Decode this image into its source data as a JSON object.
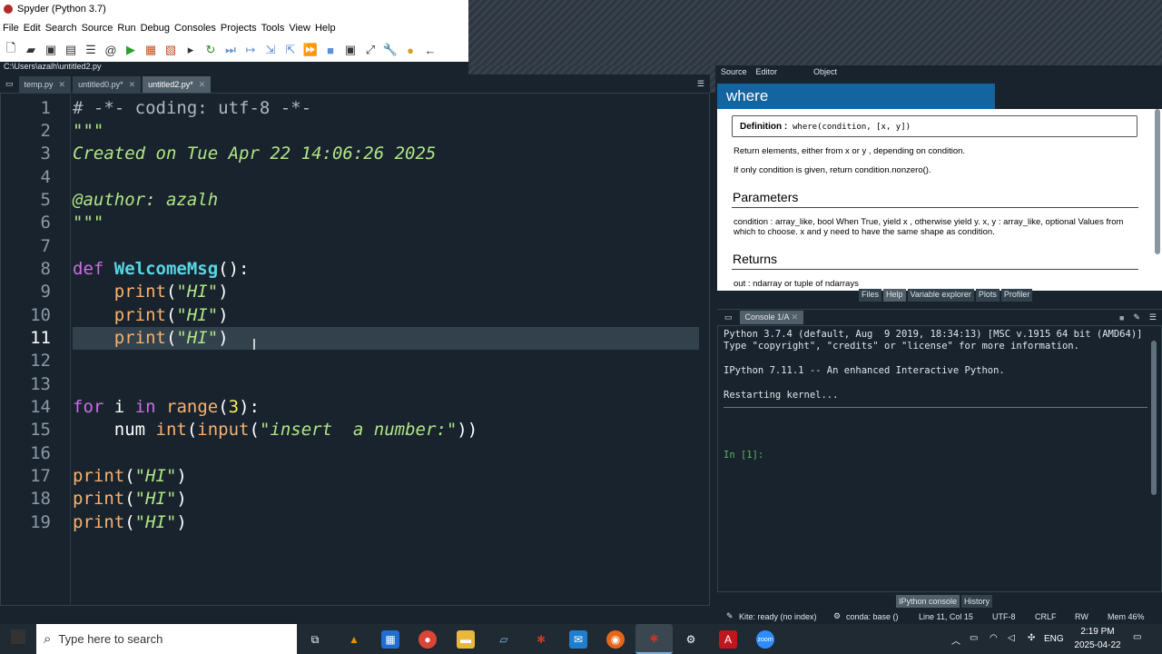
{
  "window": {
    "title": "Spyder (Python 3.7)"
  },
  "menu": [
    "File",
    "Edit",
    "Search",
    "Source",
    "Run",
    "Debug",
    "Consoles",
    "Projects",
    "Tools",
    "View",
    "Help"
  ],
  "path": "C:\\Users\\azalh\\untitled2.py",
  "file_tabs": [
    {
      "label": "temp.py"
    },
    {
      "label": "untitled0.py*"
    },
    {
      "label": "untitled2.py*"
    }
  ],
  "editor": {
    "line_numbers": [
      "1",
      "2",
      "3",
      "4",
      "5",
      "6",
      "7",
      "8",
      "9",
      "10",
      "11",
      "12",
      "13",
      "14",
      "15",
      "16",
      "17",
      "18",
      "19"
    ],
    "current_line": "11"
  },
  "help": {
    "tabs": {
      "source": "Source",
      "editor": "Editor",
      "object": "Object"
    },
    "title": "where",
    "definition_label": "Definition :",
    "definition_sig": "where(condition, [x, y])",
    "p1": "Return elements, either from x or y , depending on condition.",
    "p2": "If only condition is given, return condition.nonzero().",
    "params_heading": "Parameters",
    "params_text1": "condition : array_like, bool When True, yield x , otherwise yield y. x, y : array_like, optional Values from",
    "params_text2": "which to choose. x and y need to have the same shape as condition.",
    "returns_heading": "Returns",
    "returns_text": "out : ndarray or tuple of ndarrays",
    "bottom_tabs": [
      "Files",
      "Help",
      "Variable explorer",
      "Plots",
      "Profiler"
    ]
  },
  "console": {
    "tab": "Console 1/A",
    "lines": [
      "Python 3.7.4 (default, Aug  9 2019, 18:34:13) [MSC v.1915 64 bit (AMD64)]",
      "Type \"copyright\", \"credits\" or \"license\" for more information.",
      "IPython 7.11.1 -- An enhanced Interactive Python.",
      "Restarting kernel..."
    ],
    "prompt": "In [1]:",
    "bottom_tabs": [
      "IPython console",
      "History"
    ]
  },
  "status": {
    "kite": "Kite: ready (no index)",
    "conda": "conda: base ()",
    "position": "Line 11, Col 15",
    "encoding": "UTF-8",
    "eol": "CRLF",
    "rw": "RW",
    "mem": "Mem 46%"
  },
  "taskbar": {
    "search_placeholder": "Type here to search",
    "lang": "ENG",
    "time": "2:19 PM",
    "date": "2025-04-22"
  }
}
